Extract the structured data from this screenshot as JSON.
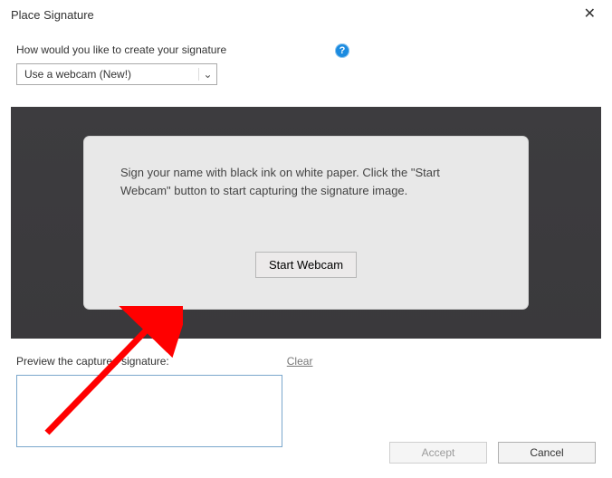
{
  "dialog": {
    "title": "Place Signature",
    "close_glyph": "✕"
  },
  "top": {
    "question": "How would you like to create your signature",
    "help_glyph": "?",
    "dropdown_value": "Use a webcam (New!)",
    "chevron": "⌄"
  },
  "capture": {
    "message": "Sign your name with black ink on white paper. Click the \"Start Webcam\" button to start capturing the signature image.",
    "start_label": "Start Webcam"
  },
  "preview": {
    "label": "Preview the captured signature:",
    "clear_label": "Clear"
  },
  "footer": {
    "accept_label": "Accept",
    "cancel_label": "Cancel"
  }
}
